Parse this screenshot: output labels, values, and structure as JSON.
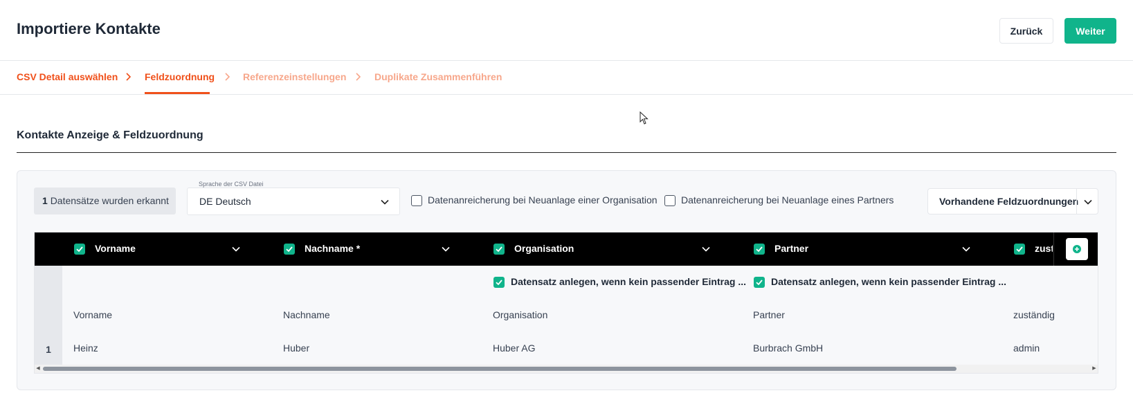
{
  "header": {
    "title": "Importiere Kontakte",
    "back_label": "Zurück",
    "next_label": "Weiter"
  },
  "steps": [
    {
      "label": "CSV Detail auswählen",
      "state": "done"
    },
    {
      "label": "Feldzuordnung",
      "state": "active"
    },
    {
      "label": "Referenzeinstellungen",
      "state": "pending"
    },
    {
      "label": "Duplikate Zusammenführen",
      "state": "pending"
    }
  ],
  "section": {
    "title": "Kontakte Anzeige & Feldzuordnung"
  },
  "toolbar": {
    "records_count": "1",
    "records_text": "Datensätze wurden erkannt",
    "language_label": "Sprache der CSV Datei",
    "language_value": "DE Deutsch",
    "enrich_org_label": "Datenanreicherung bei Neuanlage einer Organisation",
    "enrich_partner_label": "Datenanreicherung bei Neuanlage eines Partners",
    "existing_mappings_label": "Vorhandene Feldzuordnungen"
  },
  "table": {
    "columns": [
      {
        "name": "Vorname",
        "checked": true
      },
      {
        "name": "Nachname *",
        "checked": true
      },
      {
        "name": "Organisation",
        "checked": true
      },
      {
        "name": "Partner",
        "checked": true
      },
      {
        "name": "zust",
        "checked": true
      }
    ],
    "create_record_label_org": "Datensatz anlegen, wenn kein passender Eintrag ...",
    "create_record_label_partner": "Datensatz anlegen, wenn kein passender Eintrag ...",
    "source_headers": [
      "Vorname",
      "Nachname",
      "Organisation",
      "Partner",
      "zuständig"
    ],
    "rows": [
      {
        "index": "1",
        "cells": [
          "Heinz",
          "Huber",
          "Huber AG",
          "Burbrach GmbH",
          "admin"
        ]
      }
    ]
  },
  "colors": {
    "accent_orange": "#f0501a",
    "accent_orange_light": "#f7a78b",
    "primary_green": "#10b48b",
    "table_header_bg": "#000000"
  },
  "icons": {
    "step_separator": "chevron-right-icon",
    "dropdown": "chevron-down-icon",
    "add_column": "plus-circle-icon",
    "checkbox_checked": "check-icon"
  }
}
